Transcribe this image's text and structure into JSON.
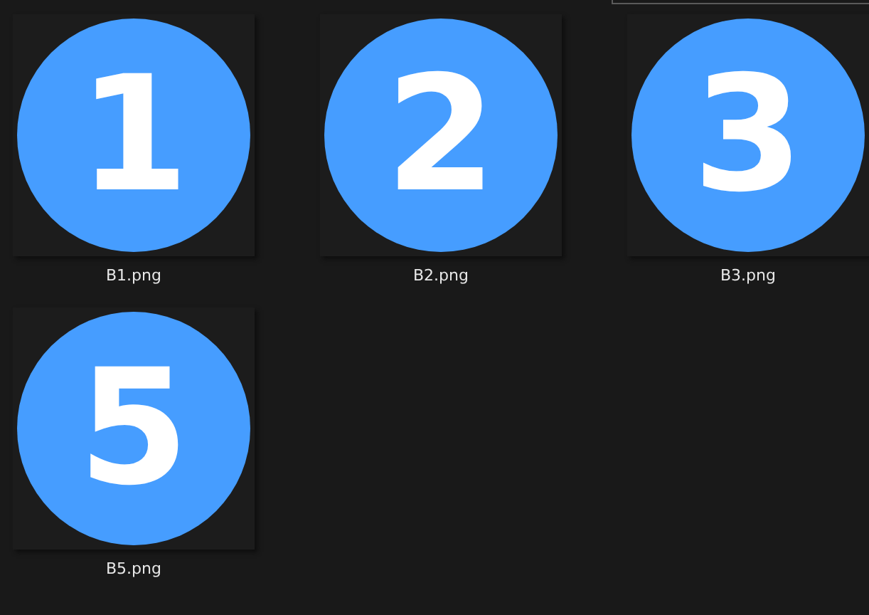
{
  "files": [
    {
      "name": "B1.png",
      "thumbnail_text": "1"
    },
    {
      "name": "B2.png",
      "thumbnail_text": "2"
    },
    {
      "name": "B3.png",
      "thumbnail_text": "3"
    },
    {
      "name": "B5.png",
      "thumbnail_text": "5"
    }
  ]
}
